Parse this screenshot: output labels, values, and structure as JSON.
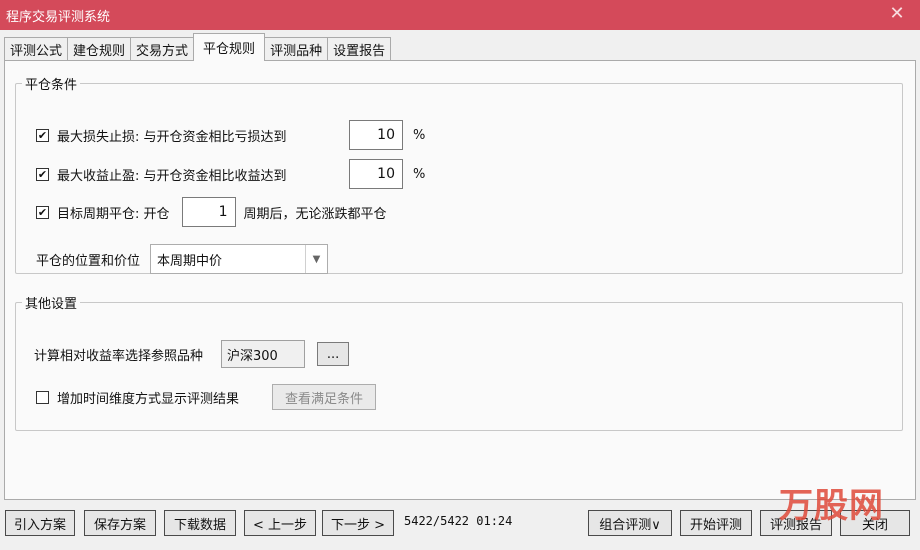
{
  "window": {
    "title": "程序交易评测系统",
    "close_glyph": "✕"
  },
  "tabs": [
    {
      "label": "评测公式",
      "active": false
    },
    {
      "label": "建仓规则",
      "active": false
    },
    {
      "label": "交易方式",
      "active": false
    },
    {
      "label": "平仓规则",
      "active": true
    },
    {
      "label": "评测品种",
      "active": false
    },
    {
      "label": "设置报告",
      "active": false
    }
  ],
  "close_rules": {
    "legend": "平仓条件",
    "max_loss": {
      "checked": true,
      "check_glyph": "✔",
      "label": "最大损失止损: 与开仓资金相比亏损达到",
      "value": "10",
      "unit": "%"
    },
    "max_profit": {
      "checked": true,
      "check_glyph": "✔",
      "label": "最大收益止盈: 与开仓资金相比收益达到",
      "value": "10",
      "unit": "%"
    },
    "target_period": {
      "checked": true,
      "check_glyph": "✔",
      "label_before": "目标周期平仓: 开仓",
      "value": "1",
      "label_after": "周期后，无论涨跌都平仓"
    },
    "position": {
      "label": "平仓的位置和价位",
      "selected": "本周期中价",
      "arrow_glyph": "▼"
    }
  },
  "other_settings": {
    "legend": "其他设置",
    "reference": {
      "label": "计算相对收益率选择参照品种",
      "value": "沪深300",
      "browse_label": "..."
    },
    "time_dimension": {
      "checked": false,
      "label": "增加时间维度方式显示评测结果",
      "view_button": "查看满足条件"
    }
  },
  "bottom_bar": {
    "import": "引入方案",
    "save": "保存方案",
    "download": "下载数据",
    "prev": "< 上一步",
    "next": "下一步 >",
    "status": "5422/5422 01:24",
    "combo_eval": "组合评测∨",
    "start": "开始评测",
    "report": "评测报告",
    "close": "关闭"
  },
  "watermark": "万股网"
}
